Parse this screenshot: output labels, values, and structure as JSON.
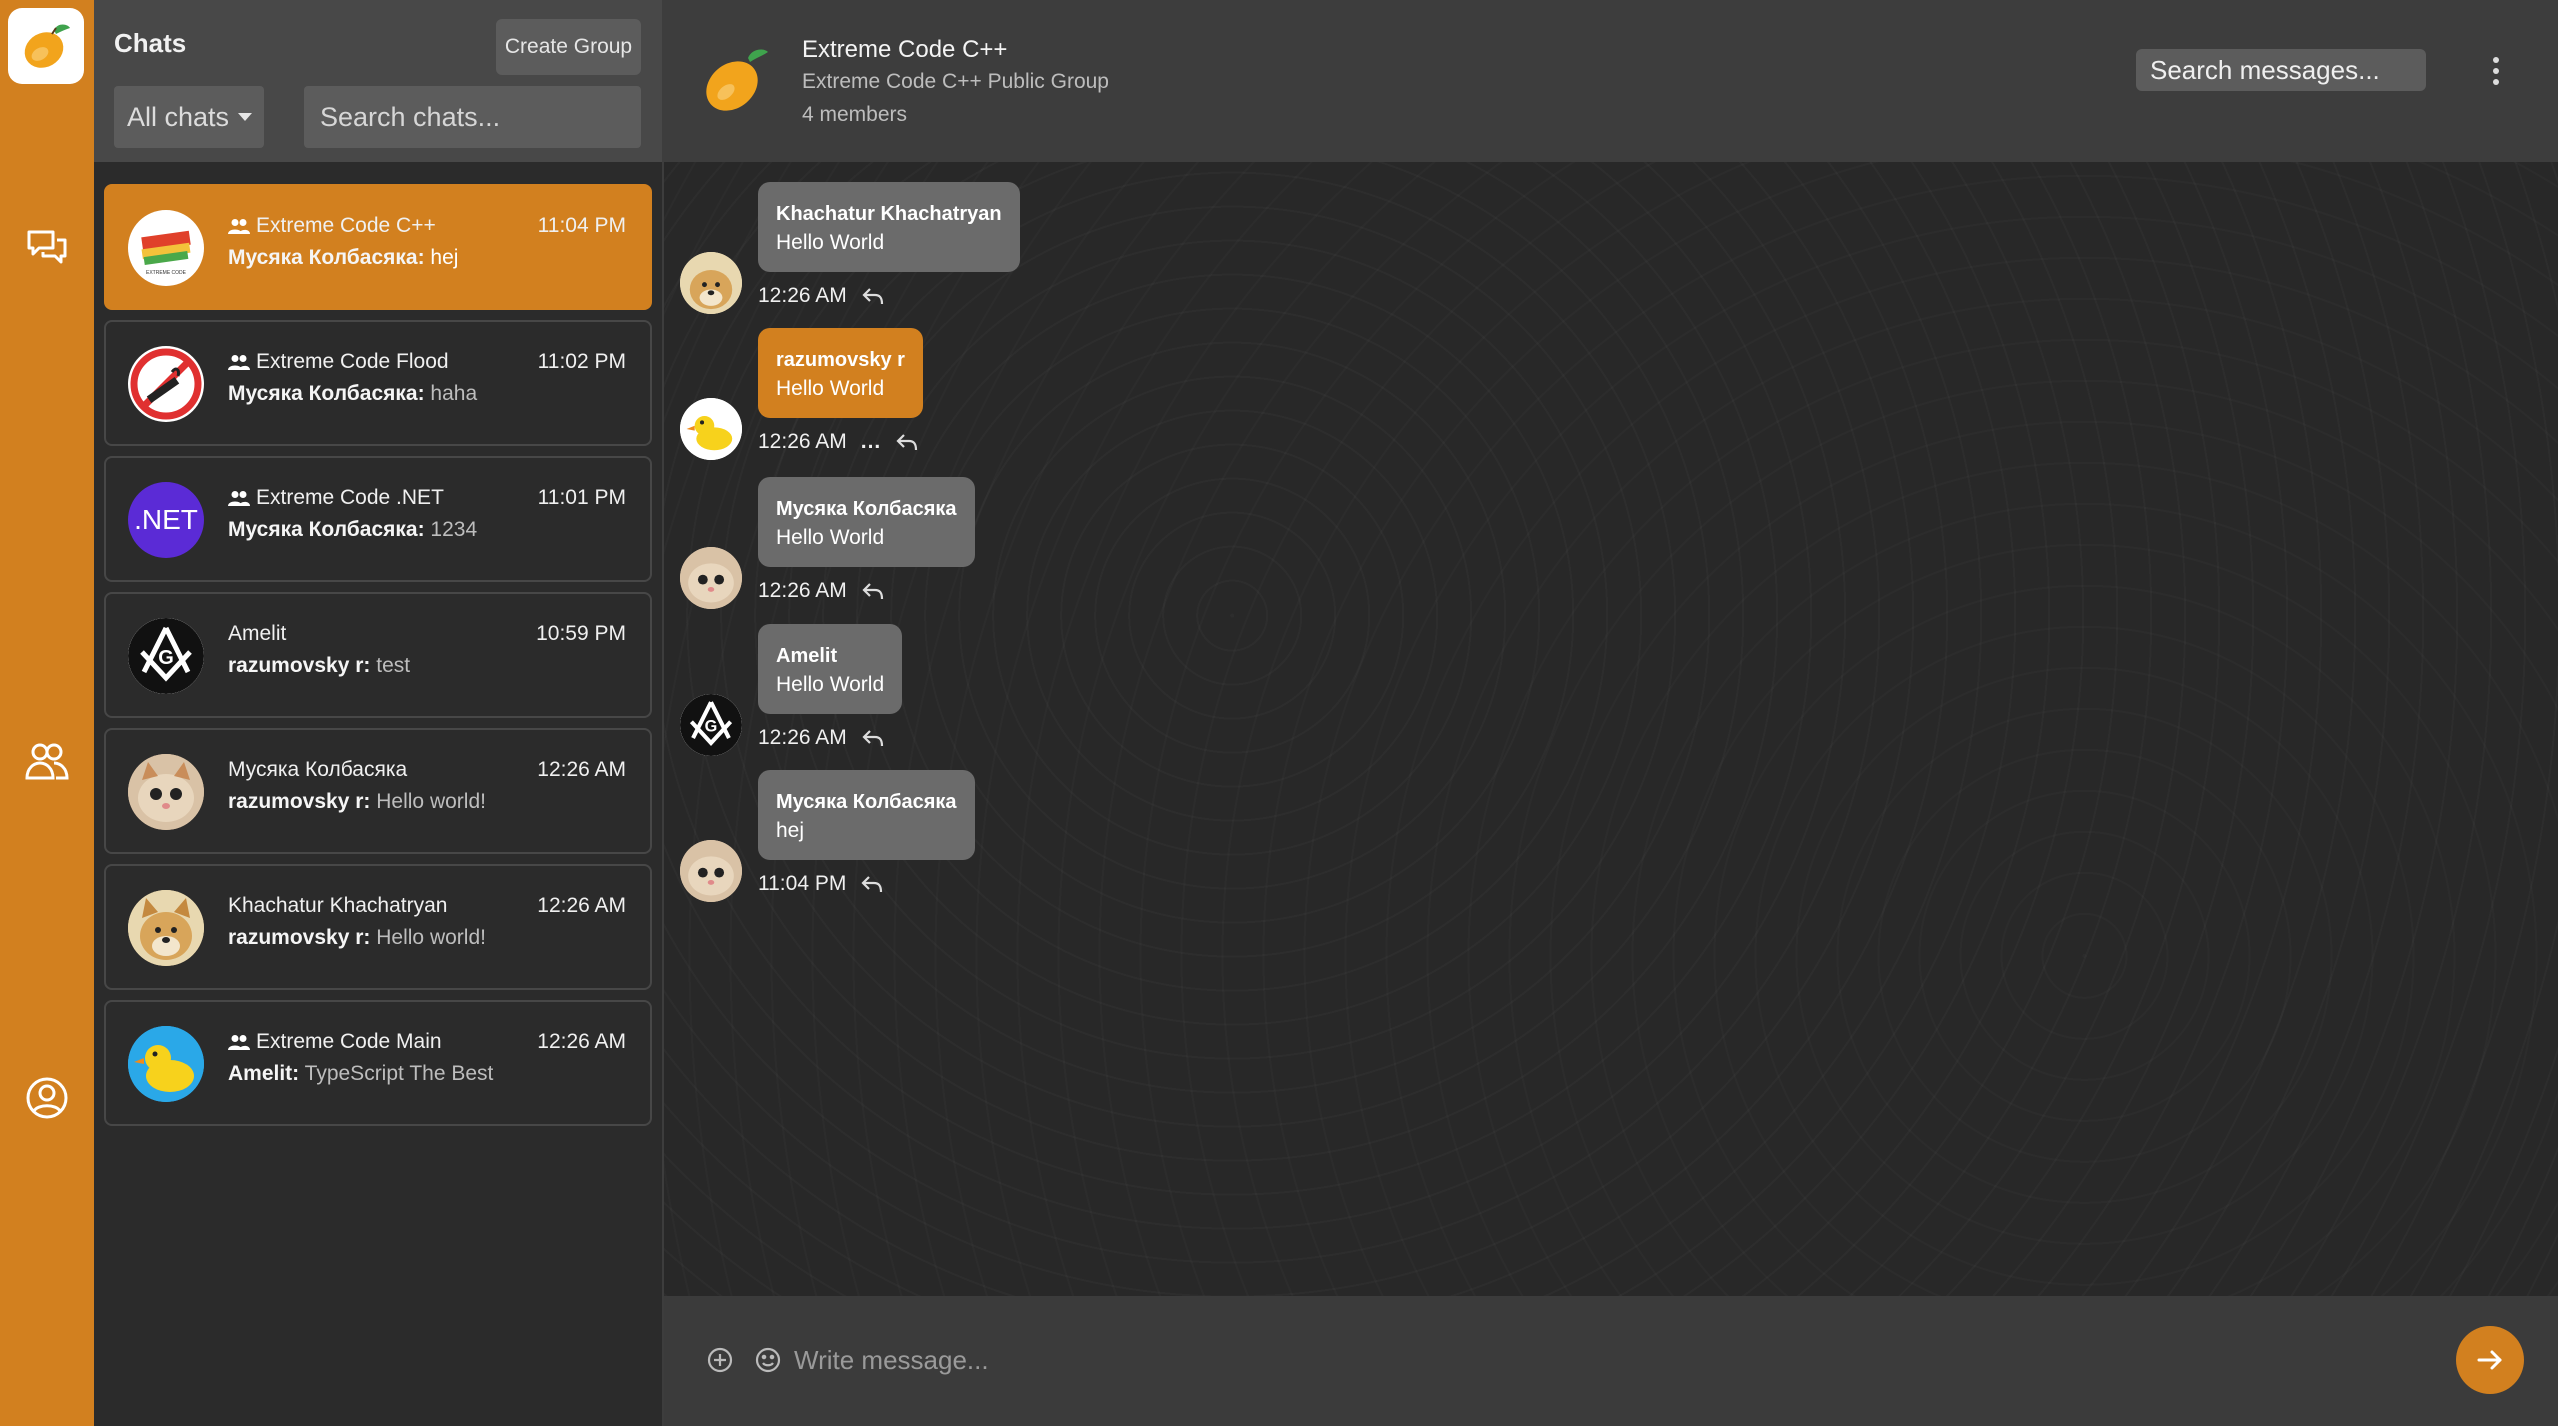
{
  "colors": {
    "accent": "#d2801f",
    "panel": "#2b2b2b",
    "bubble": "#6b6b6b"
  },
  "rail": {
    "icons": [
      "mango-logo-icon",
      "chats-icon",
      "contacts-icon",
      "profile-icon"
    ]
  },
  "sidebar": {
    "title": "Chats",
    "create_group_label": "Create Group",
    "filter_value": "All chats",
    "search_placeholder": "Search chats...",
    "chats": [
      {
        "name": "Extreme Code C++",
        "group": true,
        "time": "11:04 PM",
        "sender": "Мусяка Колбасяка:",
        "preview": "hej",
        "active": true
      },
      {
        "name": "Extreme Code Flood",
        "group": true,
        "time": "11:02 PM",
        "sender": "Мусяка Колбасяка:",
        "preview": "haha",
        "active": false
      },
      {
        "name": "Extreme Code .NET",
        "group": true,
        "time": "11:01 PM",
        "sender": "Мусяка Колбасяка:",
        "preview": "1234",
        "active": false,
        "avatar_text": ".NET"
      },
      {
        "name": "Amelit",
        "group": false,
        "time": "10:59 PM",
        "sender": "razumovsky r:",
        "preview": "test",
        "active": false
      },
      {
        "name": "Мусяка Колбасяка",
        "group": false,
        "time": "12:26 AM",
        "sender": "razumovsky r:",
        "preview": "Hello world!",
        "active": false
      },
      {
        "name": "Khachatur Khachatryan",
        "group": false,
        "time": "12:26 AM",
        "sender": "razumovsky r:",
        "preview": "Hello world!",
        "active": false
      },
      {
        "name": "Extreme Code Main",
        "group": true,
        "time": "12:26 AM",
        "sender": "Amelit:",
        "preview": "TypeScript The Best",
        "active": false
      }
    ]
  },
  "header": {
    "title": "Extreme Code C++",
    "subtitle": "Extreme Code C++ Public Group",
    "members": "4 members",
    "search_placeholder": "Search messages..."
  },
  "messages": [
    {
      "sender": "Khachatur Khachatryan",
      "text": "Hello World",
      "time": "12:26 AM",
      "own": false,
      "more": false
    },
    {
      "sender": "razumovsky r",
      "text": "Hello World",
      "time": "12:26 AM",
      "own": true,
      "more": true
    },
    {
      "sender": "Мусяка Колбасяка",
      "text": "Hello World",
      "time": "12:26 AM",
      "own": false,
      "more": false
    },
    {
      "sender": "Amelit",
      "text": "Hello World",
      "time": "12:26 AM",
      "own": false,
      "more": false
    },
    {
      "sender": "Мусяка Колбасяка",
      "text": "hej",
      "time": "11:04 PM",
      "own": false,
      "more": false
    }
  ],
  "composer": {
    "placeholder": "Write message...",
    "more_glyph": "..."
  }
}
